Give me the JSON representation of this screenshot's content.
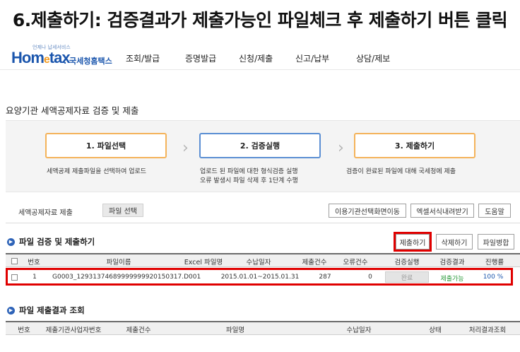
{
  "banner": {
    "text": "6.제출하기: 검증결과가 제출가능인 파일체크 후 제출하기 버튼 클릭"
  },
  "logo": {
    "tagline": "언제나 납세서비스",
    "brand_prefix": "Hom",
    "brand_e": "e",
    "brand_suffix": "tax",
    "brand_kr": ". 국세청홈택스"
  },
  "nav": {
    "items": [
      "조회/발급",
      "증명발급",
      "신청/제출",
      "신고/납부",
      "상담/제보"
    ]
  },
  "page": {
    "title": "요양기관 세액공제자료 검증 및 제출"
  },
  "steps": [
    {
      "label": "1. 파일선택",
      "desc": "세액공제 제출파일을 선택하여 업로드"
    },
    {
      "label": "2. 검증실행",
      "desc_line1": "업로드 된 파일에 대한 형식검증 실행",
      "desc_line2": "오류 발생시 파일 삭제 후 1단계 수행"
    },
    {
      "label": "3. 제출하기",
      "desc": "검증이 완료된 파일에 대해 국세청에 제출"
    }
  ],
  "toolbar": {
    "label": "세액공제자료 제출",
    "file_select": "파일 선택",
    "buttons": [
      "이용기관선택화면이동",
      "엑셀서식내려받기",
      "도움말"
    ]
  },
  "verify_section": {
    "title": "파일 검증 및 제출하기",
    "actions": [
      "제출하기",
      "삭제하기",
      "파일병합"
    ],
    "columns": [
      "번호",
      "파일이름",
      "Excel 파일명",
      "수납일자",
      "제출건수",
      "오류건수",
      "검증실행",
      "검증결과",
      "진행률"
    ],
    "rows": [
      {
        "no": "1",
        "filename": "G0003_12931374689999999920150317.D001",
        "excel": "",
        "period": "2015.01.01~2015.01.31",
        "submit_count": "287",
        "error_count": "0",
        "verify": "완료",
        "result": "제출가능",
        "progress": "100 %"
      }
    ]
  },
  "result_section": {
    "title": "파일 제출결과 조회",
    "columns": [
      "번호",
      "제출기관사업자번호",
      "제출건수",
      "파일명",
      "수납일자",
      "상태",
      "처리결과조회"
    ]
  },
  "colors": {
    "accent_red": "#e00000",
    "brand_blue": "#1b56ad",
    "result_green": "#2a9a3a",
    "progress_blue": "#1b56ad"
  }
}
